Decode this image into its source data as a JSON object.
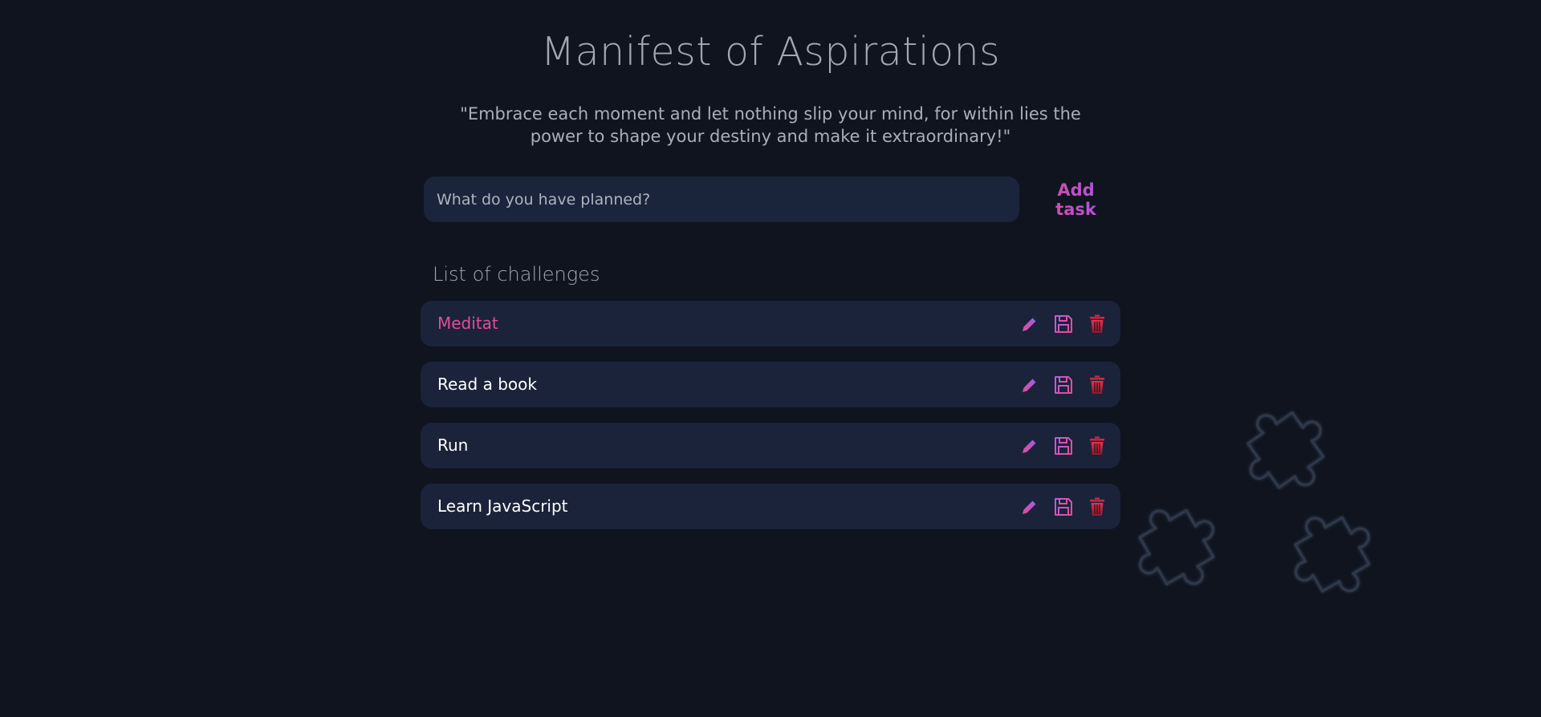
{
  "header": {
    "title": "Manifest of Aspirations",
    "quote": "\"Embrace each moment and let nothing slip your mind, for within lies the power to shape your destiny and make it extraordinary!\""
  },
  "add_form": {
    "placeholder": "What do you have planned?",
    "value": "",
    "add_label": "Add task"
  },
  "list": {
    "heading": "List of challenges",
    "tasks": [
      {
        "text": "Meditat",
        "state": "active"
      },
      {
        "text": "Read a book",
        "state": "normal"
      },
      {
        "text": "Run",
        "state": "normal"
      },
      {
        "text": "Learn JavaScript",
        "state": "normal"
      }
    ],
    "actions": [
      "pencil-icon",
      "floppy-disk-icon",
      "trash-icon"
    ]
  },
  "colors": {
    "background": "#0f141f",
    "card": "#1a233a",
    "accent_pink": "#e64c98",
    "accent_purple": "#9d5bea",
    "delete_red": "#c0213a",
    "muted_text": "#a2a7b2"
  },
  "decoration": {
    "icon": "puzzle-pieces-icon"
  }
}
